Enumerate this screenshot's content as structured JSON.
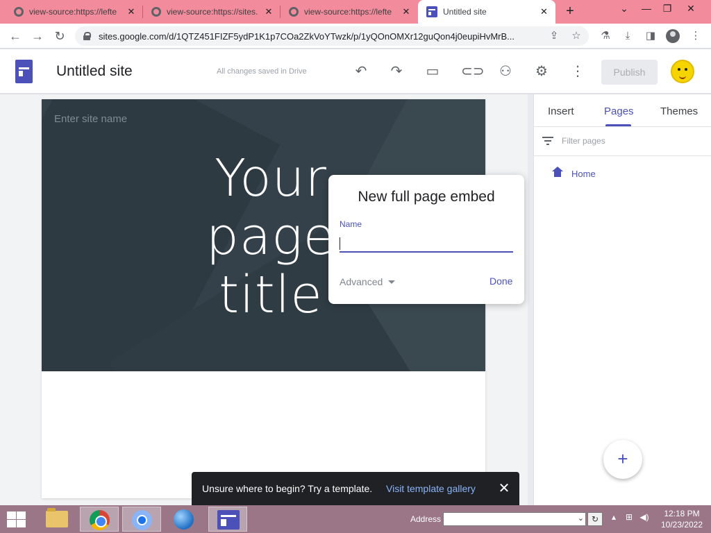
{
  "browser": {
    "tabs": [
      {
        "label": "view-source:https://lefte",
        "close": "✕"
      },
      {
        "label": "view-source:https://sites.",
        "close": "✕"
      },
      {
        "label": "view-source:https://lefte",
        "close": "✕"
      },
      {
        "label": "Untitled site",
        "close": "✕"
      }
    ],
    "new_tab": "+",
    "url": "sites.google.com/d/1QTZ451FIZF5ydP1K1p7COa2ZkVoYTwzk/p/1yQOnOMXr12guQon4j0eupiHvMrB..."
  },
  "header": {
    "site_title": "Untitled site",
    "save_status": "All changes saved in Drive",
    "publish_label": "Publish"
  },
  "canvas": {
    "site_name_placeholder": "Enter site name",
    "page_title_lines": [
      "Your",
      "page",
      "title"
    ]
  },
  "dialog": {
    "title": "New full page embed",
    "field_label": "Name",
    "name_value": "",
    "advanced_label": "Advanced",
    "done_label": "Done"
  },
  "panel": {
    "tabs": [
      "Insert",
      "Pages",
      "Themes"
    ],
    "active_tab": "Pages",
    "filter_placeholder": "Filter pages",
    "pages": [
      {
        "label": "Home"
      }
    ]
  },
  "snackbar": {
    "message": "Unsure where to begin? Try a template.",
    "link": "Visit template gallery"
  },
  "taskbar": {
    "address_label": "Address",
    "time": "12:18 PM",
    "date": "10/23/2022"
  },
  "colors": {
    "accent": "#4b51b8",
    "tabstrip": "#f28b9b",
    "banner": "#34414a",
    "taskbar": "#9a7686"
  }
}
